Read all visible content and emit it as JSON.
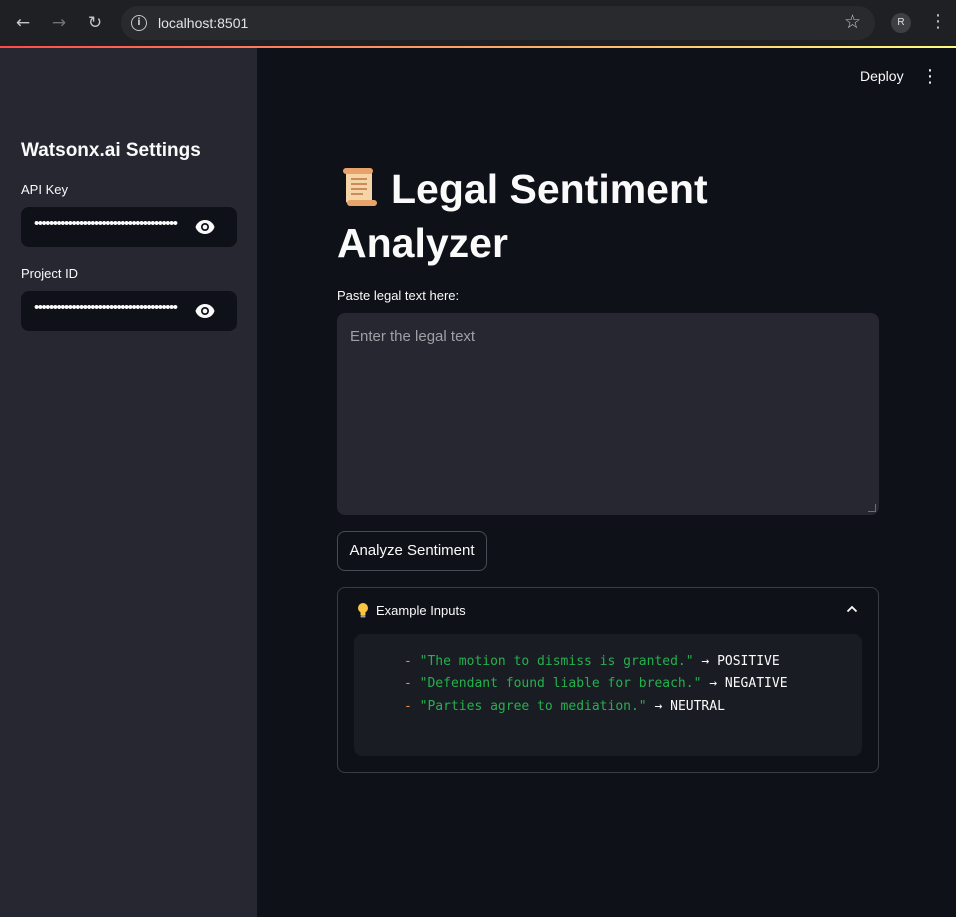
{
  "browser": {
    "url": "localhost:8501",
    "profile_initial": "R"
  },
  "sidebar": {
    "title": "Watsonx.ai Settings",
    "api_key_label": "API Key",
    "api_key_value": "••••••••••••••••••••••••••••••••••••••",
    "project_id_label": "Project ID",
    "project_id_value": "••••••••••••••••••••••••••••••••••••••"
  },
  "header": {
    "deploy_label": "Deploy"
  },
  "main": {
    "title": "Legal Sentiment Analyzer",
    "title_icon": "scroll-icon",
    "textarea_label": "Paste legal text here:",
    "textarea_placeholder": "Enter the legal text",
    "analyze_button": "Analyze Sentiment",
    "expander": {
      "title": "Example Inputs",
      "icon": "lightbulb-icon",
      "expanded": true,
      "examples": [
        {
          "dash": "-",
          "text": "\"The motion to dismiss is granted.\"",
          "arrow": "→",
          "label": "POSITIVE"
        },
        {
          "dash": "-",
          "text": "\"Defendant found liable for breach.\"",
          "arrow": "→",
          "label": "NEGATIVE"
        },
        {
          "dash": "-",
          "text": "\"Parties agree to mediation.\"",
          "arrow": "→",
          "label": "NEUTRAL"
        }
      ]
    }
  },
  "colors": {
    "accent": "#ff4b4b",
    "background": "#0e1117",
    "sidebar": "#262730",
    "code_string": "#23b14d",
    "code_dash": "#f08c4a"
  }
}
